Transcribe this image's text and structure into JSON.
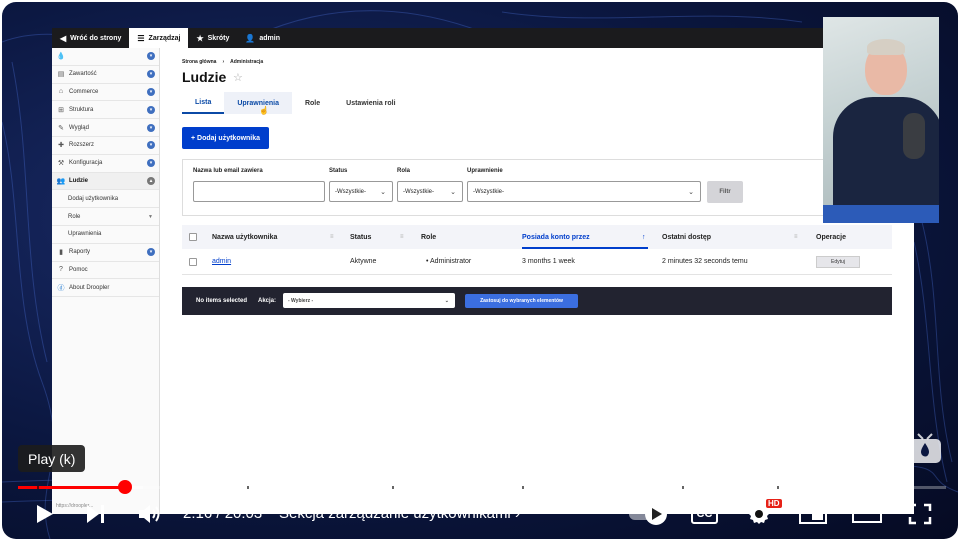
{
  "toolbar": {
    "back": "Wróć do strony",
    "manage": "Zarządzaj",
    "shortcuts": "Skróty",
    "user": "admin"
  },
  "sidebar": {
    "items": [
      {
        "label": "Zawartość"
      },
      {
        "label": "Commerce"
      },
      {
        "label": "Struktura"
      },
      {
        "label": "Wygląd"
      },
      {
        "label": "Rozszerz"
      },
      {
        "label": "Konfiguracja"
      },
      {
        "label": "Ludzie"
      },
      {
        "label": "Dodaj użytkownika"
      },
      {
        "label": "Role"
      },
      {
        "label": "Uprawnienia"
      },
      {
        "label": "Raporty"
      },
      {
        "label": "Pomoc"
      },
      {
        "label": "About Droopler"
      }
    ]
  },
  "breadcrumb": {
    "home": "Strona główna",
    "sep": "›",
    "admin": "Administracja"
  },
  "page": {
    "title": "Ludzie"
  },
  "tabs": [
    "Lista",
    "Uprawnienia",
    "Role",
    "Ustawienia roli"
  ],
  "add_button": "+ Dodaj użytkownika",
  "filters": {
    "name_label": "Nazwa lub email zawiera",
    "name_value": "",
    "status_label": "Status",
    "status_value": "-Wszystkie-",
    "role_label": "Rola",
    "role_value": "-Wszystkie-",
    "perm_label": "Uprawnienie",
    "perm_value": "-Wszystkie-",
    "submit": "Filtr"
  },
  "table": {
    "headers": [
      "Nazwa użytkownika",
      "Status",
      "Role",
      "Posiada konto przez",
      "Ostatni dostęp",
      "Operacje"
    ],
    "rows": [
      {
        "name": "admin",
        "status": "Aktywne",
        "role": "Administrator",
        "member_for": "3 months 1 week",
        "last_access": "2 minutes 32 seconds temu",
        "op": "Edytuj"
      }
    ]
  },
  "bulk": {
    "selected": "No items selected",
    "action_label": "Akcja:",
    "action_value": "- Wybierz -",
    "apply": "Zastosuj do wybranych elementów"
  },
  "statusbar": "https://droopler...",
  "player": {
    "tooltip": "Play (k)",
    "time": "2:16 / 20:03",
    "bullet": "•",
    "chapter": "Sekcja zarządzanie uzytkownikami",
    "hd_badge": "HD",
    "cc_label": "CC",
    "progress": 0.115,
    "buffered": 0.135
  }
}
